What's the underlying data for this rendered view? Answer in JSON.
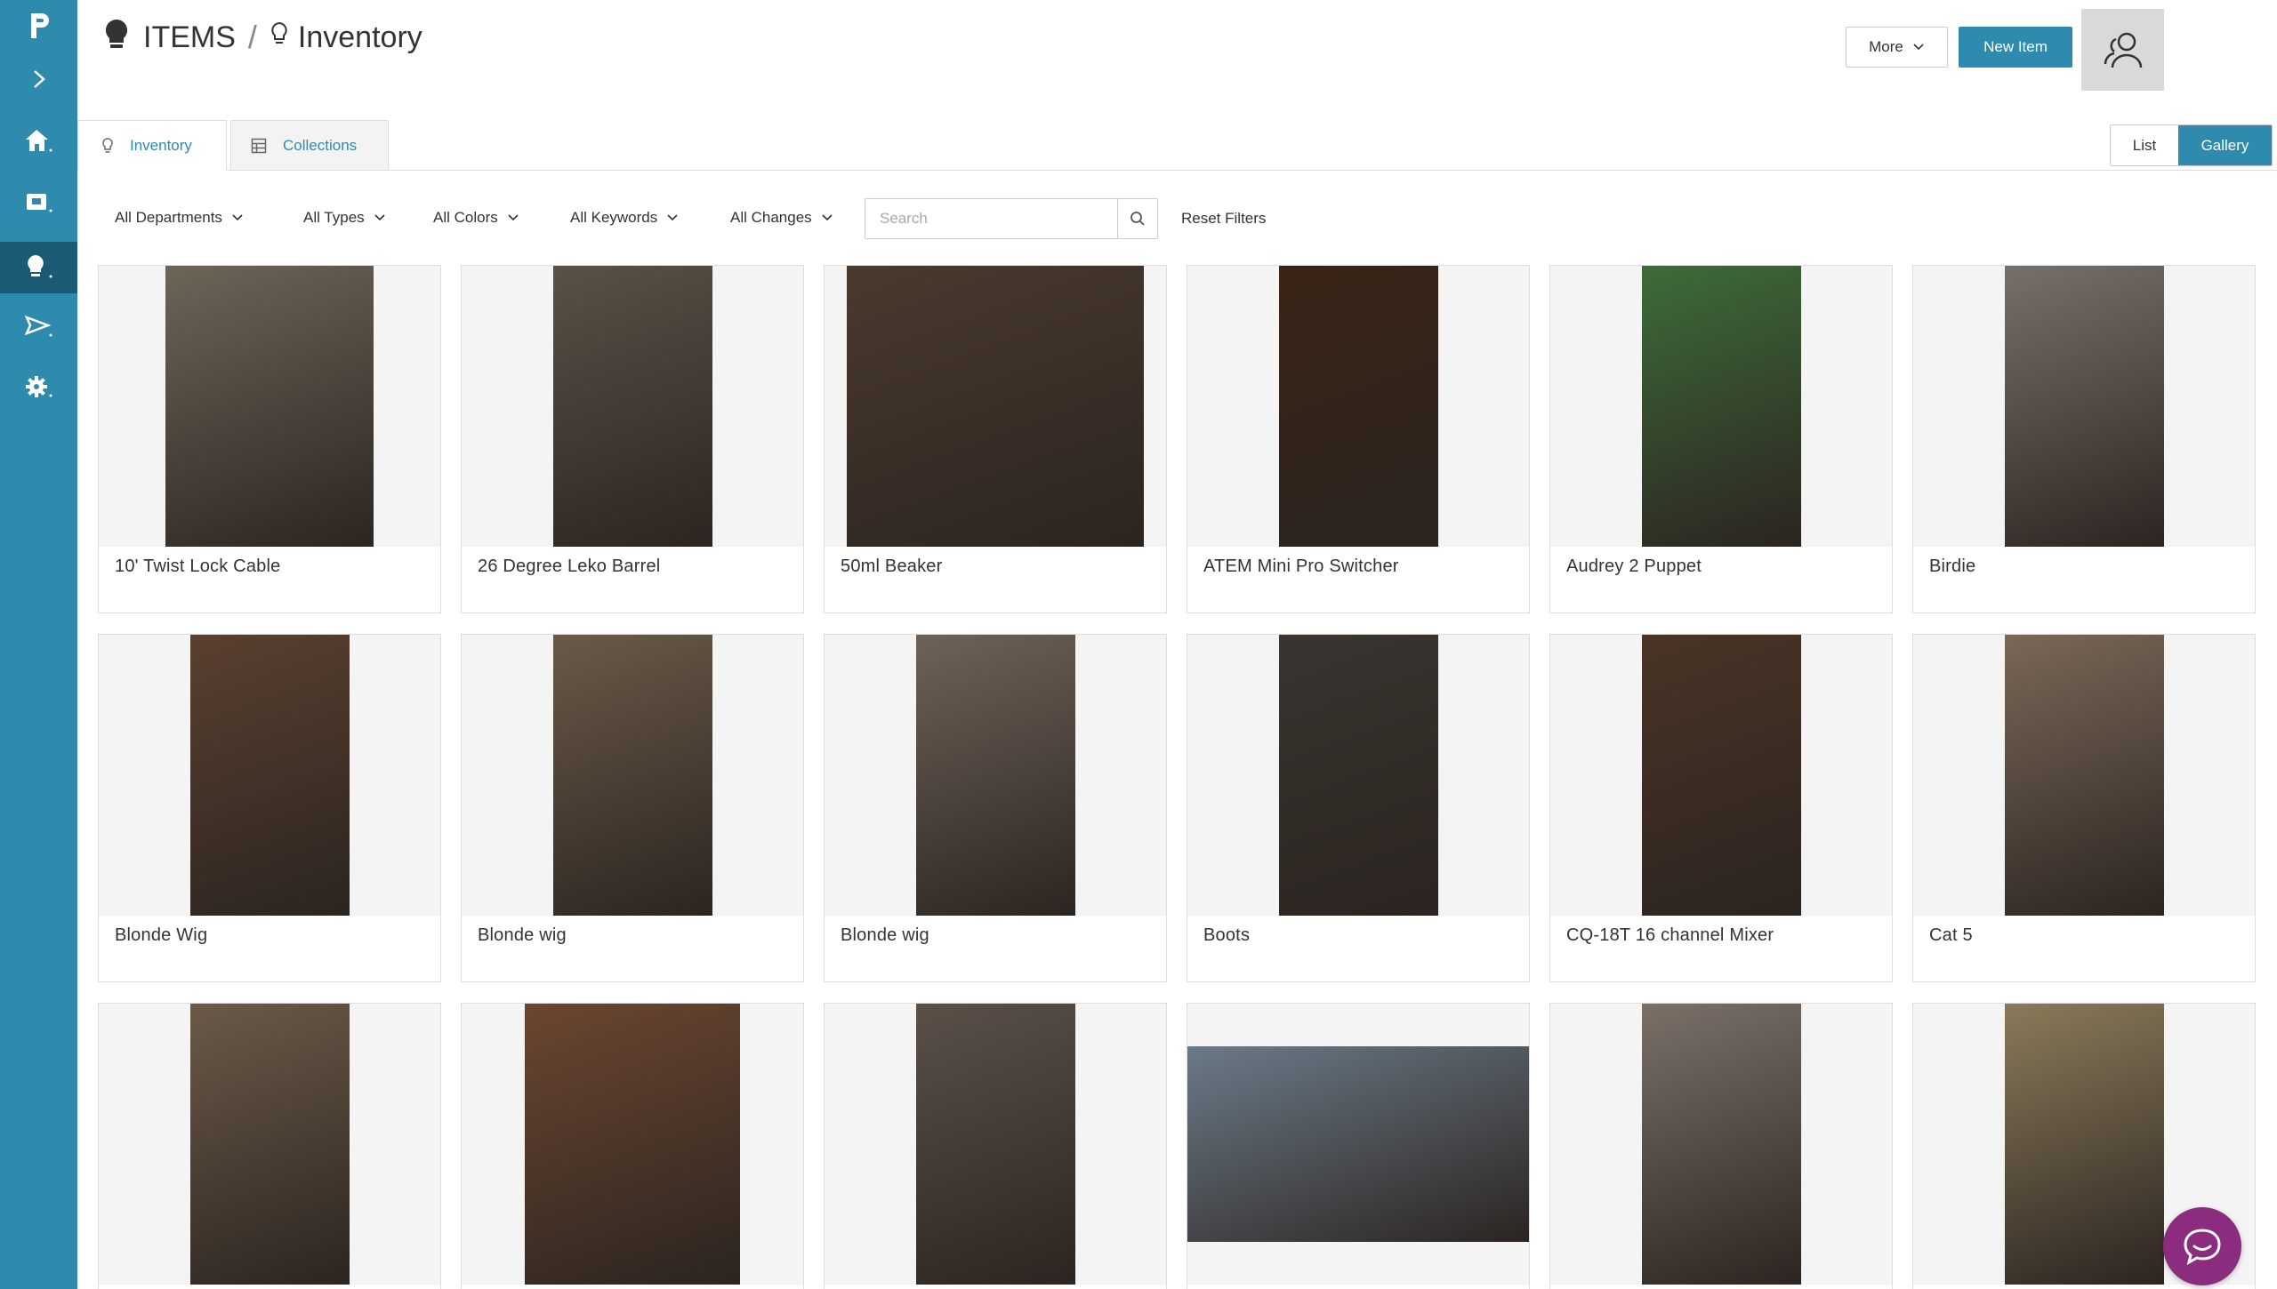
{
  "colors": {
    "brand": "#2e8bae",
    "sidebar_active": "#1a5a75",
    "chat": "#8b2c7e"
  },
  "sidebar": {
    "items": [
      {
        "icon": "logo-icon"
      },
      {
        "icon": "chevron-right-icon"
      },
      {
        "icon": "home-icon"
      },
      {
        "icon": "id-card-icon"
      },
      {
        "icon": "lightbulb-icon",
        "active": true
      },
      {
        "icon": "send-icon"
      },
      {
        "icon": "gear-icon"
      }
    ]
  },
  "header": {
    "section": "ITEMS",
    "separator": "/",
    "page": "Inventory",
    "more_label": "More",
    "new_item_label": "New Item"
  },
  "tabs": [
    {
      "label": "Inventory",
      "active": true
    },
    {
      "label": "Collections",
      "active": false
    }
  ],
  "view_toggle": {
    "list_label": "List",
    "gallery_label": "Gallery",
    "selected": "Gallery"
  },
  "filters": {
    "departments": "All Departments",
    "types": "All Types",
    "colors": "All Colors",
    "keywords": "All Keywords",
    "changes": "All Changes",
    "search_placeholder": "Search",
    "reset_label": "Reset Filters"
  },
  "items": [
    {
      "name": "10' Twist Lock Cable",
      "color": "#6e6558"
    },
    {
      "name": "26 Degree Leko Barrel",
      "color": "#5a5147"
    },
    {
      "name": "50ml Beaker",
      "color": "#4a3a2e"
    },
    {
      "name": "ATEM Mini Pro Switcher",
      "color": "#3a2416"
    },
    {
      "name": "Audrey 2 Puppet",
      "color": "#3e6b3a"
    },
    {
      "name": "Birdie",
      "color": "#77706a"
    },
    {
      "name": "Blonde Wig",
      "color": "#5a4030"
    },
    {
      "name": "Blonde wig",
      "color": "#6a5a48"
    },
    {
      "name": "Blonde wig",
      "color": "#6e6258"
    },
    {
      "name": "Boots",
      "color": "#3a3530"
    },
    {
      "name": "CQ-18T 16 channel Mixer",
      "color": "#4a3426"
    },
    {
      "name": "Cat 5",
      "color": "#7a6858"
    },
    {
      "name": "",
      "color": "#6b5a48"
    },
    {
      "name": "",
      "color": "#6b4630"
    },
    {
      "name": "",
      "color": "#5a5048"
    },
    {
      "name": "",
      "color": "#6a7a88"
    },
    {
      "name": "",
      "color": "#7a7068"
    },
    {
      "name": "",
      "color": "#8a7a5a"
    }
  ]
}
